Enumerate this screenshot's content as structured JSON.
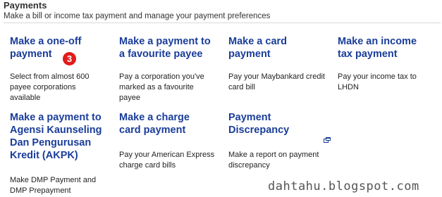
{
  "header": {
    "title": "Payments",
    "subtitle": "Make a bill or income tax payment and manage your payment preferences"
  },
  "cards": [
    {
      "title_lines": [
        "Make a one-off",
        "payment"
      ],
      "desc_lines": [
        "Select from almost 600",
        "payee corporations",
        "available"
      ]
    },
    {
      "title_lines": [
        "Make a payment to",
        "a favourite payee"
      ],
      "desc_lines": [
        "Pay a corporation you've",
        "marked as a favourite",
        "payee"
      ]
    },
    {
      "title_lines": [
        "Make a card",
        "payment"
      ],
      "desc_lines": [
        "Pay your Maybankard credit",
        "card bill"
      ]
    },
    {
      "title_lines": [
        "Make an income",
        "tax payment"
      ],
      "desc_lines": [
        "Pay your income tax to",
        "LHDN"
      ]
    },
    {
      "title_lines": [
        "Make a payment to",
        "Agensi Kaunseling",
        "Dan Pengurusan",
        "Kredit (AKPK)"
      ],
      "desc_lines": [
        "Make DMP Payment and",
        "DMP Prepayment"
      ]
    },
    {
      "title_lines": [
        "Make a charge",
        "card payment"
      ],
      "desc_lines": [
        "Pay your American Express",
        "charge card bills"
      ]
    },
    {
      "title_lines": [
        "Payment",
        "Discrepancy"
      ],
      "desc_lines": [
        "Make a report on payment",
        "discrepancy"
      ]
    }
  ],
  "annotation_badge": "3",
  "watermark": "dahtahu.blogspot.com",
  "colors": {
    "link": "#1a3d9a",
    "badge": "#e21b1b",
    "divider": "#d9d9d9"
  },
  "icons": {
    "external": "new-window-icon"
  }
}
